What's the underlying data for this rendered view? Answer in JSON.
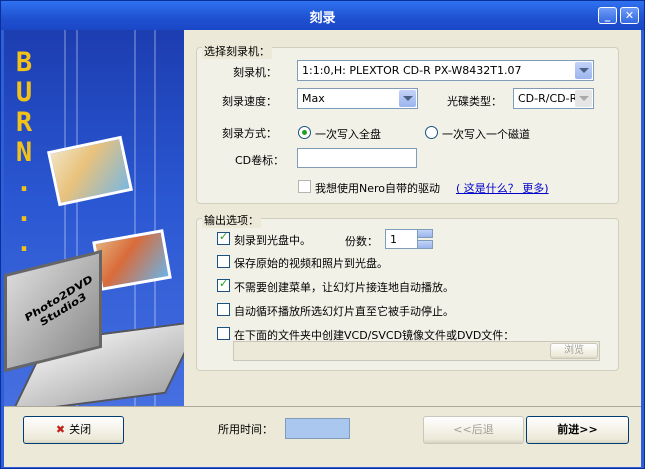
{
  "window": {
    "title": "刻录"
  },
  "side_panel": {
    "burn_text": [
      "B",
      "U",
      "R",
      "N",
      ".",
      ".",
      "."
    ],
    "product_label": "Photo2DVD Studio3"
  },
  "recorder_group": {
    "title": "选择刻录机：",
    "recorder_label": "刻录机：",
    "recorder_value": "1:1:0,H: PLEXTOR CD-R   PX-W8432T1.07",
    "speed_label": "刻录速度：",
    "speed_value": "Max",
    "disc_type_label": "光碟类型：",
    "disc_type_value": "CD-R/CD-R",
    "method_label": "刻录方式：",
    "method_options": [
      "一次写入全盘",
      "一次写入一个磁道"
    ],
    "method_selected": 0,
    "volume_label": "CD卷标：",
    "volume_value": "",
    "nero_checkbox": "我想使用Nero自带的驱动",
    "help_link": "( 这是什么？ 更多)"
  },
  "output_group": {
    "title": "输出选项：",
    "burn_to_disc": "刻录到光盘中。",
    "copies_label": "份数：",
    "copies_value": "1",
    "save_originals": "保存原始的视频和照片到光盘。",
    "no_menu": "不需要创建菜单，让幻灯片接连地自动播放。",
    "auto_loop": "自动循环播放所选幻灯片直至它被手动停止。",
    "create_image": "在下面的文件夹中创建VCD/SVCD镜像文件或DVD文件：",
    "folder_value": "",
    "browse_label": "浏览"
  },
  "footer": {
    "close_label": "关闭",
    "time_label": "所用时间：",
    "time_value": "",
    "back_label": "<<后退",
    "next_label": "前进>>"
  },
  "colors": {
    "accent": "#2e5fd8",
    "burn_text": "#f3c21a",
    "check_green": "#21a121",
    "link": "#0000cc"
  }
}
